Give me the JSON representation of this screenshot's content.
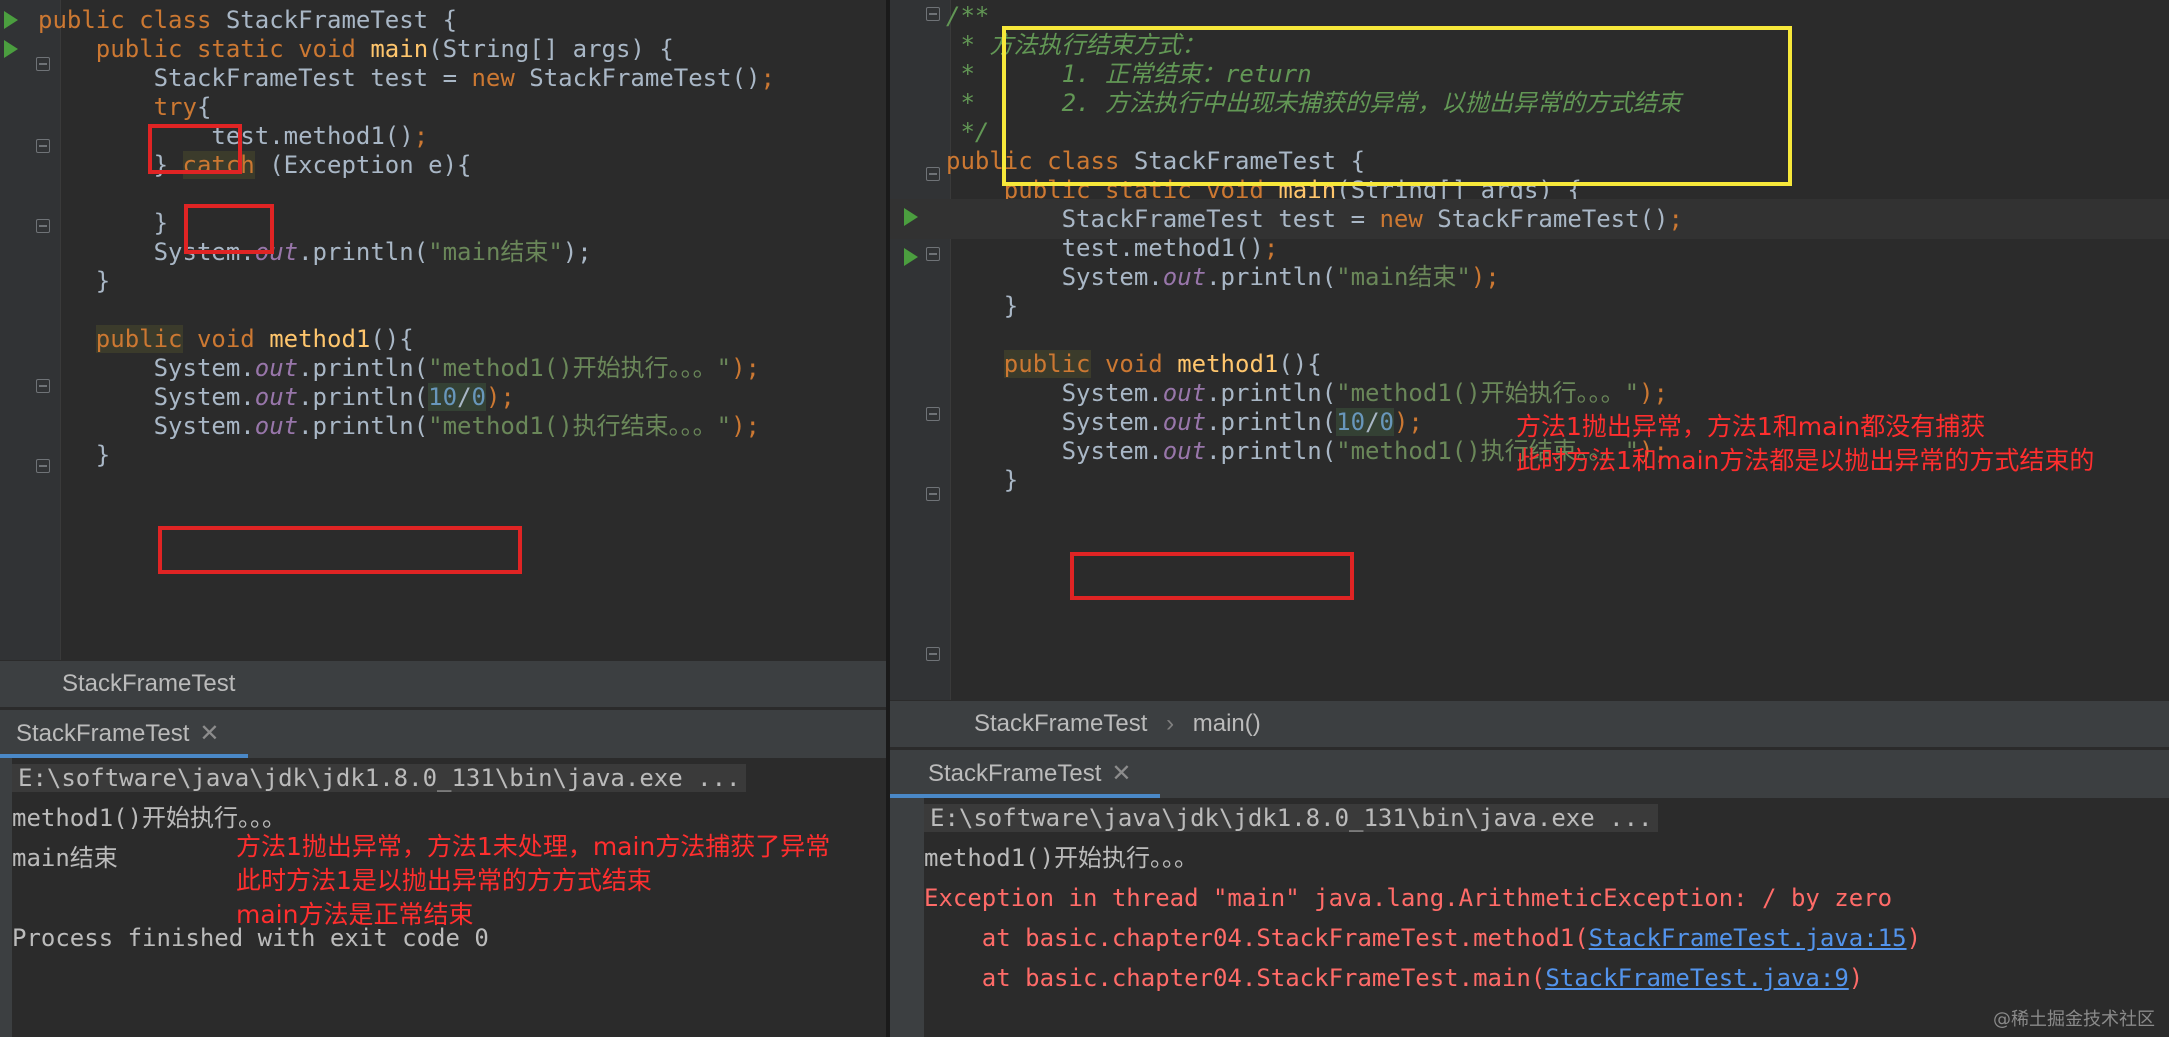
{
  "left": {
    "code_lines": [
      {
        "parts": [
          {
            "t": "public class ",
            "c": "kw"
          },
          {
            "t": "StackFrameTest {",
            "c": ""
          }
        ]
      },
      {
        "parts": [
          {
            "t": "    public static void ",
            "c": "kw"
          },
          {
            "t": "main",
            "c": "fn"
          },
          {
            "t": "(String[] args) {",
            "c": ""
          }
        ]
      },
      {
        "parts": [
          {
            "t": "        StackFrameTest test = ",
            "c": ""
          },
          {
            "t": "new ",
            "c": "kw"
          },
          {
            "t": "StackFrameTest()",
            "c": ""
          },
          {
            "t": ";",
            "c": "kw"
          }
        ]
      },
      {
        "parts": [
          {
            "t": "        ",
            "c": ""
          },
          {
            "t": "try",
            "c": "kw"
          },
          {
            "t": "{",
            "c": ""
          }
        ]
      },
      {
        "parts": [
          {
            "t": "            test.method1()",
            "c": ""
          },
          {
            "t": ";",
            "c": "kw"
          }
        ]
      },
      {
        "parts": [
          {
            "t": "        } ",
            "c": ""
          },
          {
            "t": "catch",
            "c": "kw hl"
          },
          {
            "t": " (Exception e){",
            "c": ""
          }
        ]
      },
      {
        "parts": [
          {
            "t": "",
            "c": ""
          }
        ]
      },
      {
        "parts": [
          {
            "t": "        }",
            "c": ""
          }
        ]
      },
      {
        "parts": [
          {
            "t": "        System.",
            "c": ""
          },
          {
            "t": "out",
            "c": "fld"
          },
          {
            "t": ".println(",
            "c": ""
          },
          {
            "t": "\"main结束\"",
            "c": "str"
          },
          {
            "t": ");",
            "c": ""
          }
        ]
      },
      {
        "parts": [
          {
            "t": "    }",
            "c": ""
          }
        ]
      },
      {
        "parts": [
          {
            "t": "",
            "c": ""
          }
        ]
      },
      {
        "parts": [
          {
            "t": "    ",
            "c": ""
          },
          {
            "t": "public",
            "c": "kw hl"
          },
          {
            "t": " void ",
            "c": "kw"
          },
          {
            "t": "method1",
            "c": "fn"
          },
          {
            "t": "(){",
            "c": ""
          }
        ]
      },
      {
        "parts": [
          {
            "t": "        System.",
            "c": ""
          },
          {
            "t": "out",
            "c": "fld"
          },
          {
            "t": ".println(",
            "c": ""
          },
          {
            "t": "\"method1()开始执行。。。\"",
            "c": "str"
          },
          {
            "t": ");",
            "c": "kw"
          }
        ]
      },
      {
        "parts": [
          {
            "t": "        System.",
            "c": ""
          },
          {
            "t": "out",
            "c": "fld"
          },
          {
            "t": ".println(",
            "c": ""
          },
          {
            "t": "10",
            "c": "num hl2"
          },
          {
            "t": "/",
            "c": "hl2"
          },
          {
            "t": "0",
            "c": "num hl2"
          },
          {
            "t": ");",
            "c": "kw"
          }
        ]
      },
      {
        "parts": [
          {
            "t": "        System.",
            "c": ""
          },
          {
            "t": "out",
            "c": "fld"
          },
          {
            "t": ".println(",
            "c": ""
          },
          {
            "t": "\"method1()执行结束。。。\"",
            "c": "str"
          },
          {
            "t": ");",
            "c": "kw"
          }
        ]
      },
      {
        "parts": [
          {
            "t": "    }",
            "c": ""
          }
        ]
      }
    ],
    "breadcrumb": "StackFrameTest",
    "run_tab": "StackFrameTest",
    "console": {
      "cmd": "E:\\software\\java\\jdk\\jdk1.8.0_131\\bin\\java.exe ...",
      "lines": [
        "method1()开始执行。。。",
        "main结束",
        "",
        "Process finished with exit code 0"
      ]
    },
    "annotation": "方法1抛出异常，方法1未处理，main方法捕获了异常\n此时方法1是以抛出异常的方方式结束\nmain方法是正常结束"
  },
  "right": {
    "code_lines": [
      {
        "parts": [
          {
            "t": "/**",
            "c": "cmt"
          }
        ]
      },
      {
        "parts": [
          {
            "t": " * 方法执行结束方式：",
            "c": "cmt"
          }
        ]
      },
      {
        "parts": [
          {
            "t": " *      1. 正常结束：return",
            "c": "cmt"
          }
        ]
      },
      {
        "parts": [
          {
            "t": " *      2. 方法执行中出现未捕获的异常，以抛出异常的方式结束",
            "c": "cmt"
          }
        ]
      },
      {
        "parts": [
          {
            "t": " */",
            "c": "cmt"
          }
        ]
      },
      {
        "parts": [
          {
            "t": "public class ",
            "c": "kw"
          },
          {
            "t": "StackFrameTest {",
            "c": ""
          }
        ]
      },
      {
        "parts": [
          {
            "t": "    public static void ",
            "c": "kw"
          },
          {
            "t": "main",
            "c": "fn"
          },
          {
            "t": "(String[] args) {",
            "c": ""
          }
        ]
      },
      {
        "parts": [
          {
            "t": "        StackFrameTest test = ",
            "c": ""
          },
          {
            "t": "new ",
            "c": "kw"
          },
          {
            "t": "StackFrameTest()",
            "c": ""
          },
          {
            "t": ";",
            "c": "kw"
          }
        ]
      },
      {
        "parts": [
          {
            "t": "        test.method1()",
            "c": ""
          },
          {
            "t": ";",
            "c": "kw"
          }
        ]
      },
      {
        "parts": [
          {
            "t": "        System.",
            "c": ""
          },
          {
            "t": "out",
            "c": "fld"
          },
          {
            "t": ".println(",
            "c": ""
          },
          {
            "t": "\"main结束\"",
            "c": "str"
          },
          {
            "t": ");",
            "c": "kw"
          }
        ]
      },
      {
        "parts": [
          {
            "t": "    }",
            "c": ""
          }
        ]
      },
      {
        "parts": [
          {
            "t": "",
            "c": ""
          }
        ]
      },
      {
        "parts": [
          {
            "t": "    ",
            "c": ""
          },
          {
            "t": "public",
            "c": "kw hl"
          },
          {
            "t": " void ",
            "c": "kw"
          },
          {
            "t": "method1",
            "c": "fn"
          },
          {
            "t": "(){",
            "c": ""
          }
        ]
      },
      {
        "parts": [
          {
            "t": "        System.",
            "c": ""
          },
          {
            "t": "out",
            "c": "fld"
          },
          {
            "t": ".println(",
            "c": ""
          },
          {
            "t": "\"method1()开始执行。。。\"",
            "c": "str"
          },
          {
            "t": ");",
            "c": "kw"
          }
        ]
      },
      {
        "parts": [
          {
            "t": "        System.",
            "c": ""
          },
          {
            "t": "out",
            "c": "fld"
          },
          {
            "t": ".println(",
            "c": ""
          },
          {
            "t": "10",
            "c": "num hl2"
          },
          {
            "t": "/",
            "c": "hl2"
          },
          {
            "t": "0",
            "c": "num hl2"
          },
          {
            "t": ");",
            "c": "kw"
          }
        ]
      },
      {
        "parts": [
          {
            "t": "        System.",
            "c": ""
          },
          {
            "t": "out",
            "c": "fld"
          },
          {
            "t": ".println(",
            "c": ""
          },
          {
            "t": "\"method1()执行结束。。。\"",
            "c": "str"
          },
          {
            "t": ");",
            "c": "kw"
          }
        ]
      },
      {
        "parts": [
          {
            "t": "    }",
            "c": ""
          }
        ]
      }
    ],
    "breadcrumb": [
      "StackFrameTest",
      "main()"
    ],
    "run_tab": "StackFrameTest",
    "console": {
      "cmd": "E:\\software\\java\\jdk\\jdk1.8.0_131\\bin\\java.exe ...",
      "line1": "method1()开始执行。。。",
      "exception": "Exception in thread \"main\" java.lang.ArithmeticException: / by zero",
      "trace": [
        {
          "prefix": "    at basic.chapter04.StackFrameTest.method1(",
          "link": "StackFrameTest.java:15",
          "suffix": ")"
        },
        {
          "prefix": "    at basic.chapter04.StackFrameTest.main(",
          "link": "StackFrameTest.java:9",
          "suffix": ")"
        }
      ]
    },
    "annotation": "方法1抛出异常，方法1和main都没有捕获\n此时方法1和main方法都是以抛出异常的方式结束的"
  },
  "watermark": "@稀土掘金技术社区",
  "colors": {
    "accent_red": "#e02424",
    "accent_yellow": "#f7e83a",
    "bg": "#2b2b2b"
  }
}
